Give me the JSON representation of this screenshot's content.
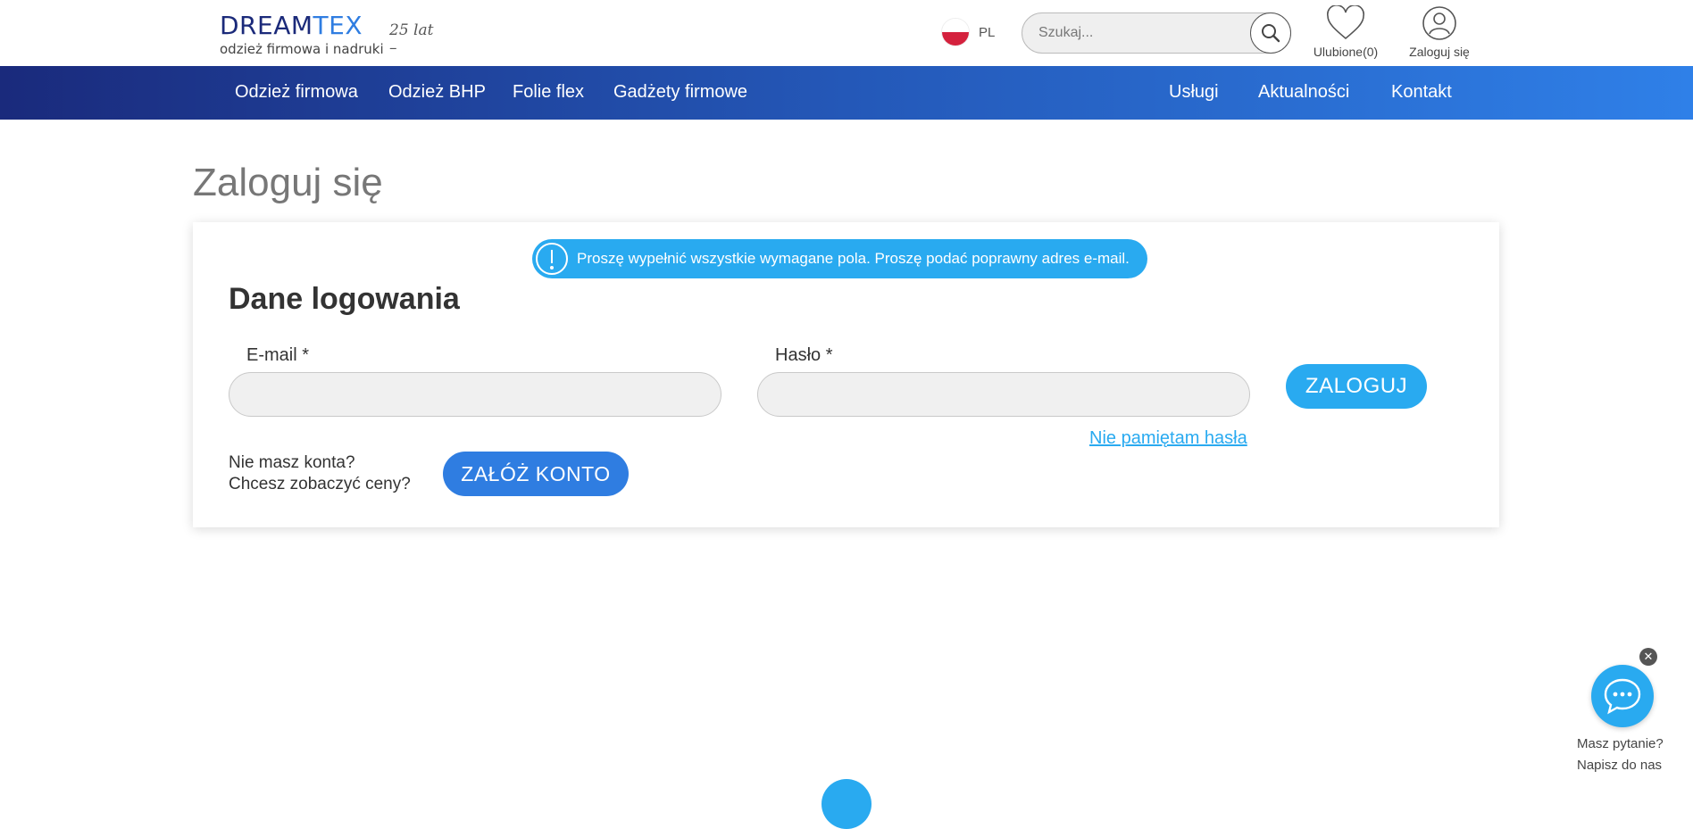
{
  "header": {
    "logo": {
      "brand_part1": "DREAM",
      "brand_part2": "TEX",
      "tagline": "odzież firmowa i nadruki",
      "anniversary": "25 lat –"
    },
    "language": {
      "label": "PL"
    },
    "search": {
      "placeholder": "Szukaj..."
    },
    "favorites": {
      "label": "Ulubione(0)"
    },
    "login": {
      "label": "Zaloguj się"
    }
  },
  "nav": {
    "left": [
      "Odzież firmowa",
      "Odzież BHP",
      "Folie flex",
      "Gadżety firmowe"
    ],
    "right": [
      "Usługi",
      "Aktualności",
      "Kontakt"
    ]
  },
  "page": {
    "title": "Zaloguj się",
    "alert": "Proszę wypełnić wszystkie wymagane pola. Proszę podać poprawny adres e-mail.",
    "section_title": "Dane logowania",
    "email_label": "E-mail *",
    "email_value": "",
    "password_label": "Hasło *",
    "password_value": "",
    "login_button": "ZALOGUJ",
    "forgot_link": "Nie pamiętam hasła",
    "no_account_line1": "Nie masz konta?",
    "no_account_line2": "Chcesz zobaczyć ceny?",
    "register_button": "ZAŁÓŻ KONTO"
  },
  "chat": {
    "line1": "Masz pytanie?",
    "line2": "Napisz do nas"
  },
  "colors": {
    "accent": "#29aaf0",
    "nav_start": "#1a2a7c",
    "nav_end": "#2f80e8",
    "register": "#2f7de1"
  }
}
